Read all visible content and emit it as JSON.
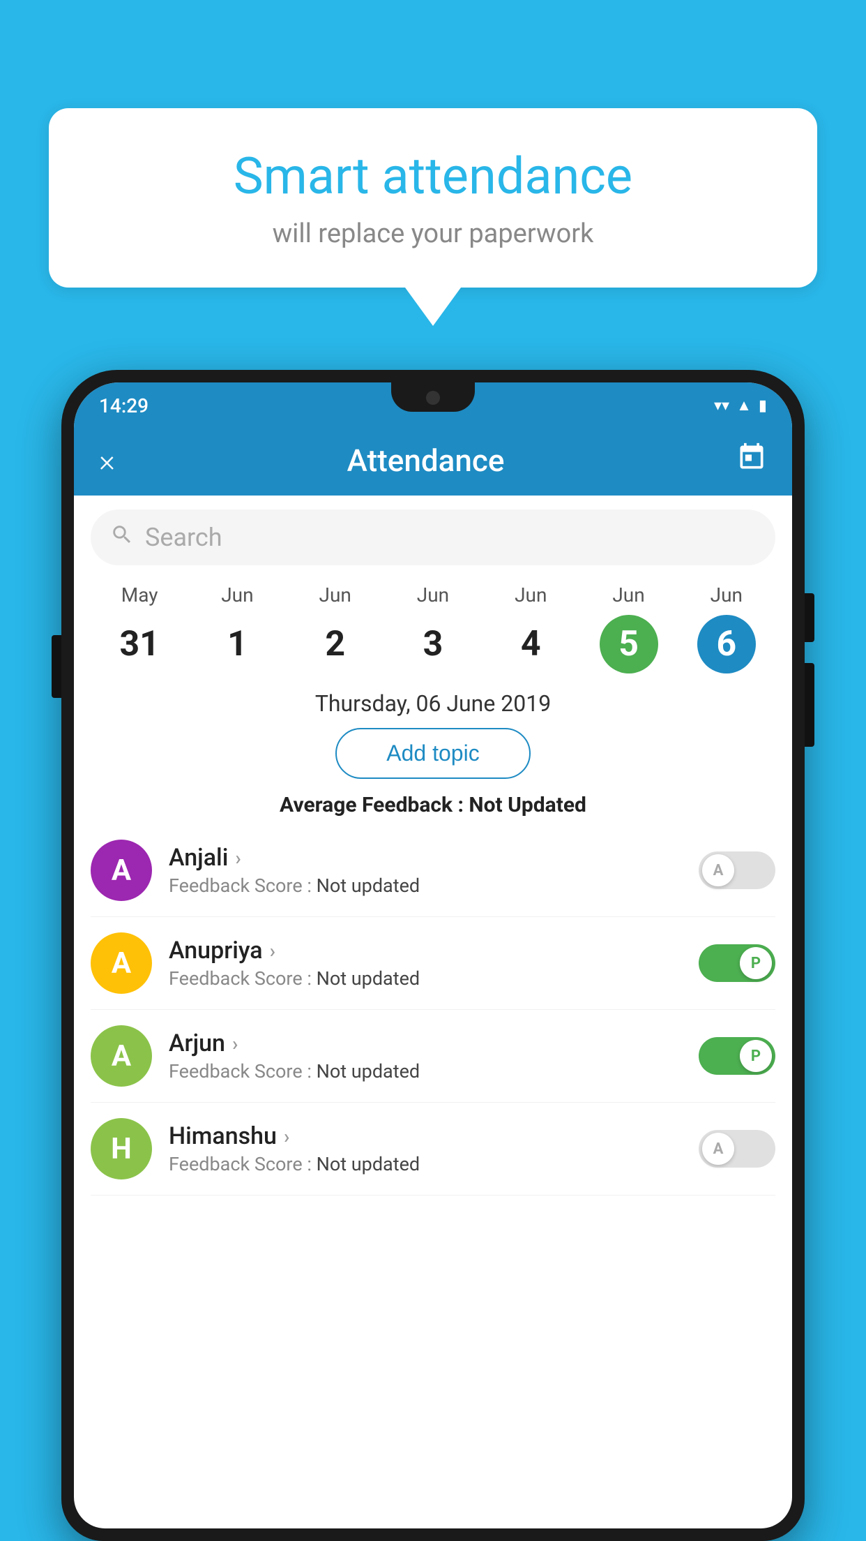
{
  "background_color": "#29b6e8",
  "speech_bubble": {
    "title": "Smart attendance",
    "subtitle": "will replace your paperwork"
  },
  "status_bar": {
    "time": "14:29",
    "wifi_icon": "▼",
    "signal_icon": "▲",
    "battery_icon": "▮"
  },
  "header": {
    "close_label": "×",
    "title": "Attendance",
    "calendar_icon": "📅"
  },
  "search": {
    "placeholder": "Search"
  },
  "calendar": {
    "days": [
      {
        "month": "May",
        "date": "31",
        "state": "normal"
      },
      {
        "month": "Jun",
        "date": "1",
        "state": "normal"
      },
      {
        "month": "Jun",
        "date": "2",
        "state": "normal"
      },
      {
        "month": "Jun",
        "date": "3",
        "state": "normal"
      },
      {
        "month": "Jun",
        "date": "4",
        "state": "normal"
      },
      {
        "month": "Jun",
        "date": "5",
        "state": "today"
      },
      {
        "month": "Jun",
        "date": "6",
        "state": "selected"
      }
    ]
  },
  "selected_date": "Thursday, 06 June 2019",
  "add_topic_label": "Add topic",
  "avg_feedback_label": "Average Feedback :",
  "avg_feedback_value": "Not Updated",
  "students": [
    {
      "name": "Anjali",
      "initial": "A",
      "avatar_color": "#9c27b0",
      "feedback_label": "Feedback Score :",
      "feedback_value": "Not updated",
      "toggle_state": "off",
      "toggle_letter": "A"
    },
    {
      "name": "Anupriya",
      "initial": "A",
      "avatar_color": "#ffc107",
      "feedback_label": "Feedback Score :",
      "feedback_value": "Not updated",
      "toggle_state": "on",
      "toggle_letter": "P"
    },
    {
      "name": "Arjun",
      "initial": "A",
      "avatar_color": "#8bc34a",
      "feedback_label": "Feedback Score :",
      "feedback_value": "Not updated",
      "toggle_state": "on",
      "toggle_letter": "P"
    },
    {
      "name": "Himanshu",
      "initial": "H",
      "avatar_color": "#8bc34a",
      "feedback_label": "Feedback Score :",
      "feedback_value": "Not updated",
      "toggle_state": "off",
      "toggle_letter": "A"
    }
  ]
}
